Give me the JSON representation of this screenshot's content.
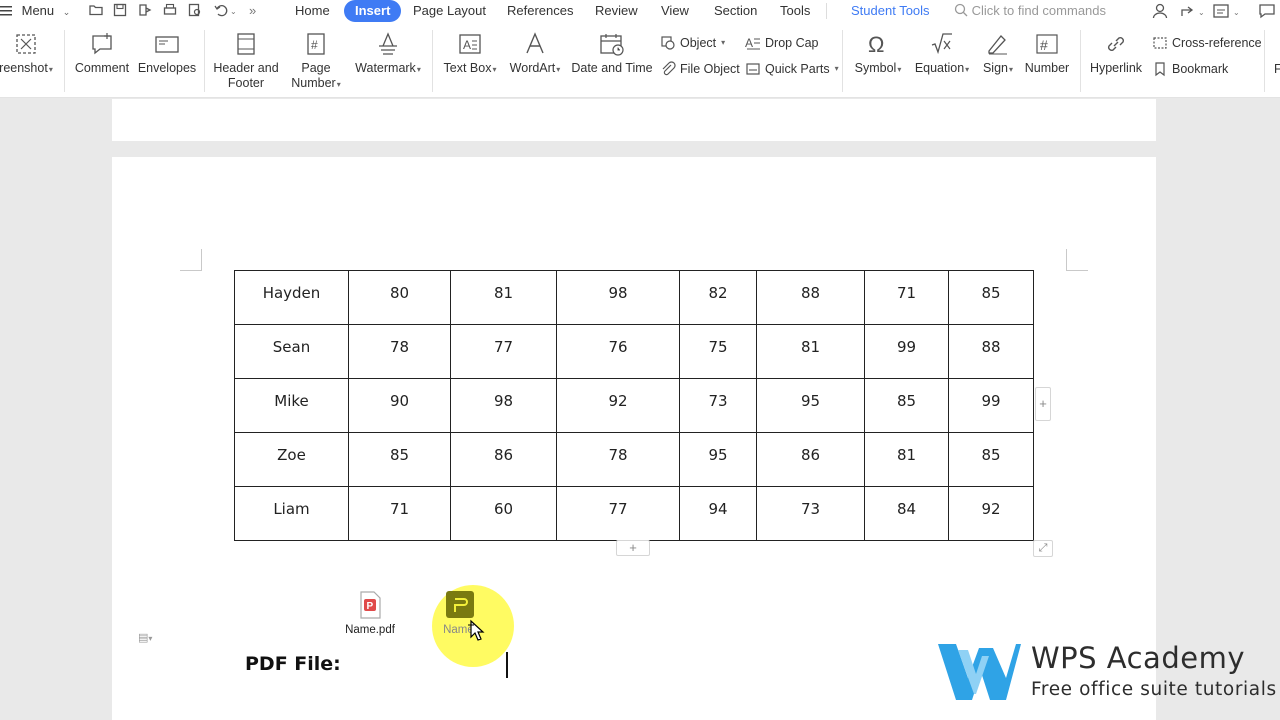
{
  "menubar": {
    "menu_label": "Menu",
    "tabs": [
      "Home",
      "Insert",
      "Page Layout",
      "References",
      "Review",
      "View",
      "Section",
      "Tools",
      "Student Tools"
    ],
    "search_placeholder": "Click to find commands"
  },
  "ribbon": {
    "screenshot": "reenshot",
    "comment": "Comment",
    "envelopes": "Envelopes",
    "header_footer_1": "Header and",
    "header_footer_2": "Footer",
    "page_number_1": "Page",
    "page_number_2": "Number",
    "watermark": "Watermark",
    "text_box": "Text Box",
    "wordart": "WordArt",
    "date_time": "Date and Time",
    "object": "Object",
    "file_object": "File Object",
    "drop_cap": "Drop Cap",
    "quick_parts": "Quick Parts",
    "symbol": "Symbol",
    "equation": "Equation",
    "sign": "Sign",
    "number": "Number",
    "hyperlink": "Hyperlink",
    "cross_reference": "Cross-reference",
    "bookmark": "Bookmark",
    "edge_partial": "F"
  },
  "table": {
    "rows": [
      [
        "Hayden",
        "80",
        "81",
        "98",
        "82",
        "88",
        "71",
        "85"
      ],
      [
        "Sean",
        "78",
        "77",
        "76",
        "75",
        "81",
        "99",
        "88"
      ],
      [
        "Mike",
        "90",
        "98",
        "92",
        "73",
        "95",
        "85",
        "99"
      ],
      [
        "Zoe",
        "85",
        "86",
        "78",
        "95",
        "86",
        "81",
        "85"
      ],
      [
        "Liam",
        "71",
        "60",
        "77",
        "94",
        "73",
        "84",
        "92"
      ]
    ]
  },
  "files": {
    "pdf_name": "Name.pdf",
    "dragging_name": "Name."
  },
  "document": {
    "pdf_label": "PDF File:"
  },
  "watermark_brand": {
    "title": "WPS Academy",
    "subtitle": "Free office suite tutorials"
  },
  "colors": {
    "accent": "#3f7bf4",
    "highlight": "#fffa46",
    "pdf_red": "#e04a4a",
    "logo_blue": "#2fa3e6"
  }
}
